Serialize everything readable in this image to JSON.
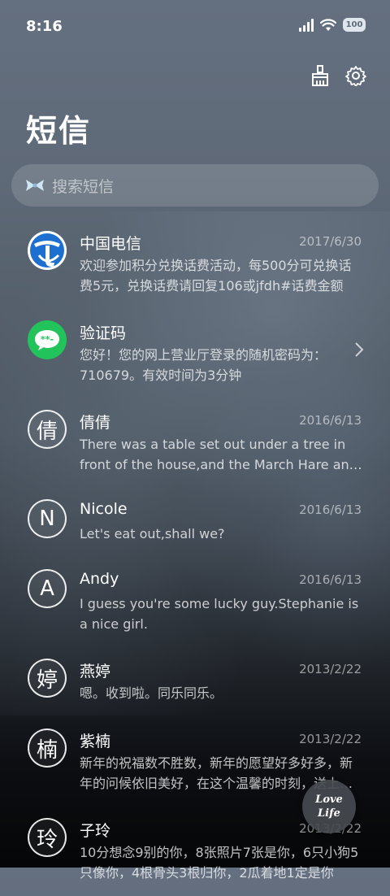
{
  "status": {
    "time": "8:16",
    "battery": "100"
  },
  "header": {
    "title": "短信"
  },
  "search": {
    "placeholder": "搜索短信"
  },
  "messages": [
    {
      "name": "中国电信",
      "date": "2017/6/30",
      "preview": "欢迎参加积分兑换话费活动，每500分可兑换话费5元，兑换话费请回复106或jfdh#话费金额",
      "avatar": "telecom-logo"
    },
    {
      "name": "验证码",
      "date": "",
      "preview": "您好！您的网上营业厅登录的随机密码为：710679。有效时间为3分钟",
      "avatar": "message-bubble",
      "avatar_text": "**-"
    },
    {
      "name": "倩倩",
      "date": "2016/6/13",
      "preview": "There was a table set out under a tree in front of the house,and the March Hare and the Hatter",
      "avatar_text": "倩"
    },
    {
      "name": "Nicole",
      "date": "2016/6/13",
      "preview": "Let's eat out,shall we?",
      "avatar_text": "N"
    },
    {
      "name": "Andy",
      "date": "2016/6/13",
      "preview": "I guess you're some lucky guy.Stephanie is a nice girl.",
      "avatar_text": "A"
    },
    {
      "name": "燕婷",
      "date": "2013/2/22",
      "preview": "嗯。收到啦。同乐同乐。",
      "avatar_text": "婷"
    },
    {
      "name": "紫楠",
      "date": "2013/2/22",
      "preview": "新年的祝福数不胜数，新年的愿望好多好多，新年的问候依旧美好，在这个温馨的时刻，送上我的祝福",
      "avatar_text": "楠"
    },
    {
      "name": "子玲",
      "date": "2013/2/22",
      "preview": "10分想念9别的你，8张照片7张是你，6只小狗5只像你，4根骨头3根归你，2瓜着地1定是你",
      "avatar_text": "玲"
    }
  ],
  "fab": {
    "line1": "Love",
    "line2": "Life"
  }
}
